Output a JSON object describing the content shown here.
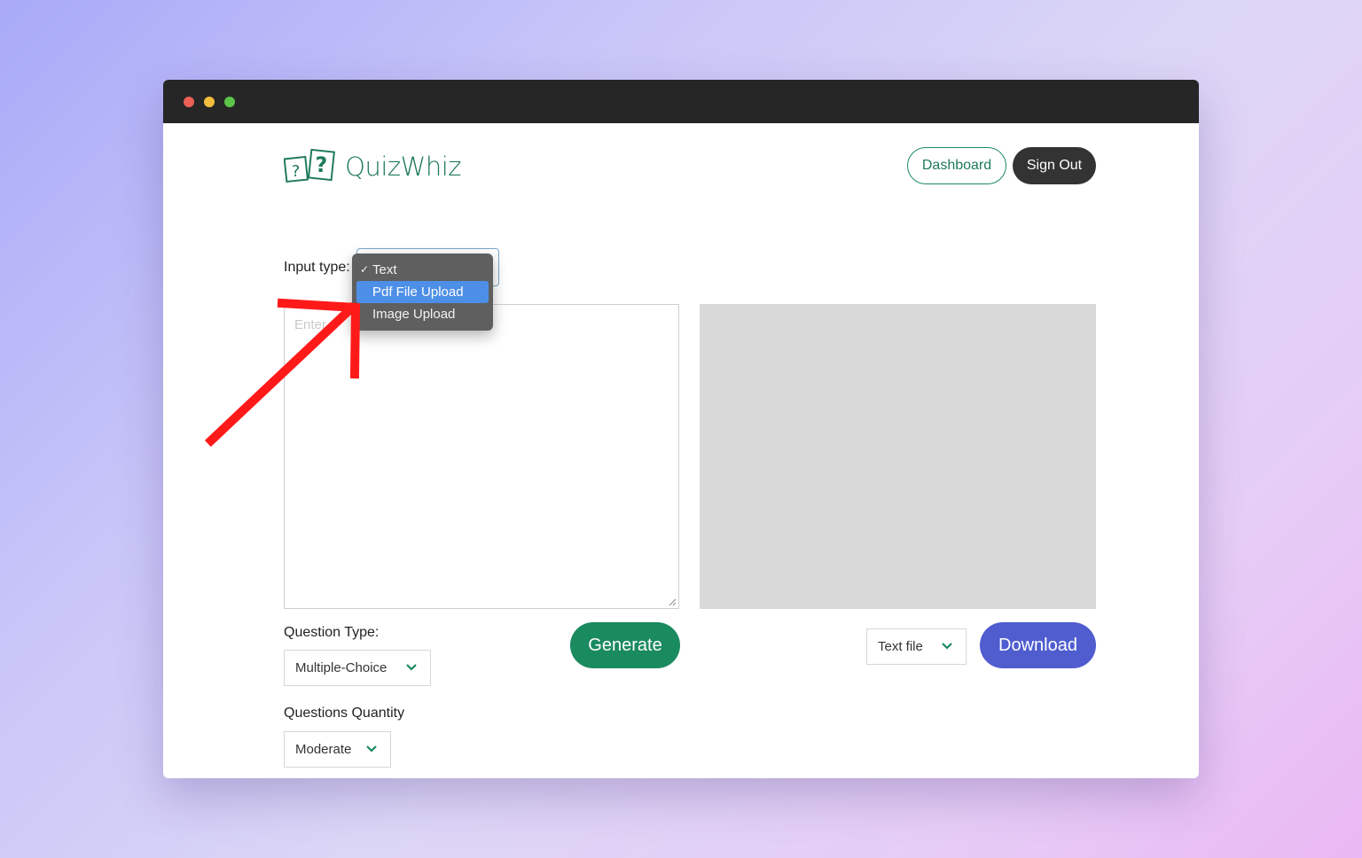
{
  "app": {
    "name": "QuizWhiz"
  },
  "header": {
    "dashboard_label": "Dashboard",
    "signout_label": "Sign Out"
  },
  "input_type": {
    "label": "Input type:",
    "options": [
      {
        "label": "Text",
        "checked": true,
        "highlighted": false
      },
      {
        "label": "Pdf File Upload",
        "checked": false,
        "highlighted": true
      },
      {
        "label": "Image Upload",
        "checked": false,
        "highlighted": false
      }
    ]
  },
  "textarea": {
    "placeholder": "Enter"
  },
  "question_type": {
    "label": "Question Type:",
    "value": "Multiple-Choice"
  },
  "questions_quantity": {
    "label": "Questions Quantity",
    "value": "Moderate"
  },
  "actions": {
    "generate_label": "Generate",
    "format_value": "Text file",
    "download_label": "Download"
  },
  "colors": {
    "brand": "#1f7a5a",
    "generate": "#1a8a5f",
    "download": "#4f5dcf",
    "highlight": "#4d8fe6",
    "annotation_arrow": "#ff1a1a"
  }
}
